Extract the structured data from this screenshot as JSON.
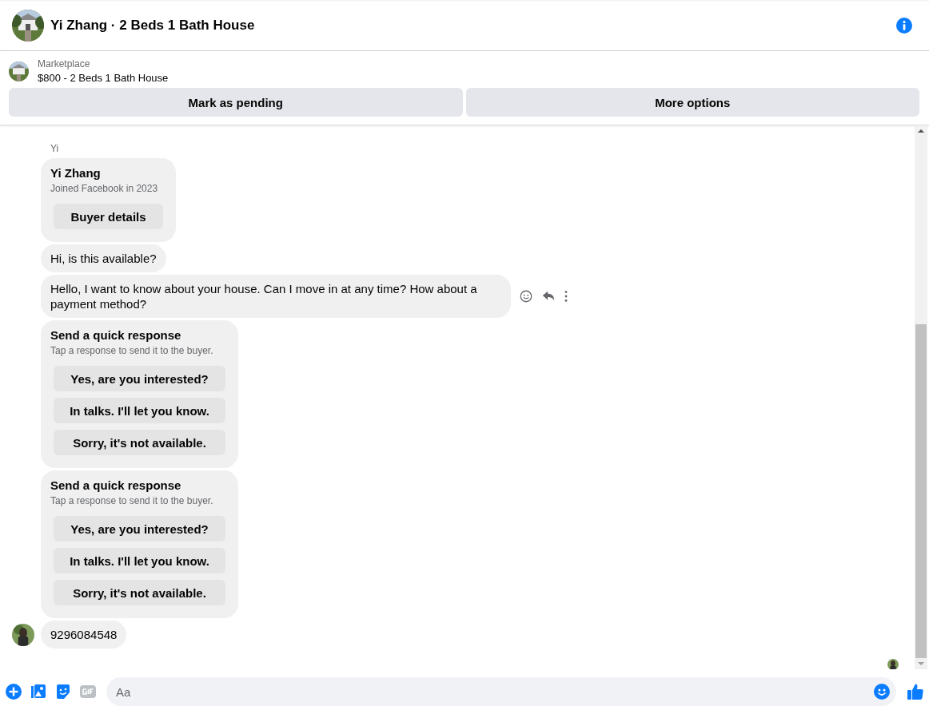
{
  "header": {
    "title": "Yi Zhang · 2 Beds 1 Bath House"
  },
  "listing": {
    "source": "Marketplace",
    "title": "$800 - 2 Beds 1 Bath House",
    "buttons": [
      "Mark as pending",
      "More options"
    ]
  },
  "messages": [
    {
      "kind": "sender",
      "text": "Yi"
    },
    {
      "kind": "profile",
      "name": "Yi Zhang",
      "subtitle": "Joined Facebook in 2023",
      "button": "Buyer details"
    },
    {
      "kind": "text",
      "text": "Hi, is this available?",
      "avatar": false,
      "actions": false
    },
    {
      "kind": "text",
      "text": "Hello, I want to know about your house. Can I move in at any time? How about a payment method?",
      "avatar": false,
      "actions": true
    },
    {
      "kind": "quick",
      "title": "Send a quick response",
      "subtitle": "Tap a response to send it to the buyer.",
      "options": [
        "Yes, are you interested?",
        "In talks. I'll let you know.",
        "Sorry, it's not available."
      ]
    },
    {
      "kind": "quick",
      "title": "Send a quick response",
      "subtitle": "Tap a response to send it to the buyer.",
      "options": [
        "Yes, are you interested?",
        "In talks. I'll let you know.",
        "Sorry, it's not available."
      ]
    },
    {
      "kind": "text",
      "text": "9296084548",
      "avatar": true,
      "actions": false
    }
  ],
  "composer": {
    "placeholder": "Aa"
  }
}
